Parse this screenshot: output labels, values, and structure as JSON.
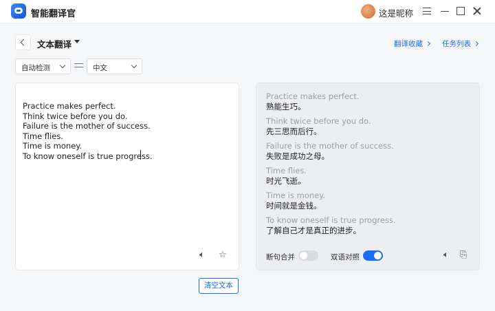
{
  "app": {
    "title": "智能翻译官",
    "username": "这是昵称"
  },
  "header": {
    "page_title": "文本翻译",
    "link_favorites": "翻译收藏",
    "link_tasks": "任务列表"
  },
  "lang": {
    "source": "自动检测",
    "target": "中文"
  },
  "source_text": "Practice makes perfect.\nThink twice before you do.\nFailure is the mother of success.\nTime flies.\nTime is money.\nTo know oneself is true progress.",
  "translations": [
    {
      "src": "Practice makes perfect.",
      "tgt": "熟能生巧。"
    },
    {
      "src": "Think twice before you do.",
      "tgt": "先三思而后行。"
    },
    {
      "src": "Failure is the mother of success.",
      "tgt": "失败是成功之母。"
    },
    {
      "src": "Time flies.",
      "tgt": "时光飞逝。"
    },
    {
      "src": "Time is money.",
      "tgt": "时间就是金钱。"
    },
    {
      "src": "To know oneself is true progress.",
      "tgt": "了解自己才是真正的进步。"
    }
  ],
  "options": {
    "merge_sentences_label": "断句合并",
    "merge_sentences_on": false,
    "bilingual_label": "双语对照",
    "bilingual_on": true
  },
  "buttons": {
    "clear": "清空文本"
  },
  "colors": {
    "accent": "#1a6ef5"
  }
}
